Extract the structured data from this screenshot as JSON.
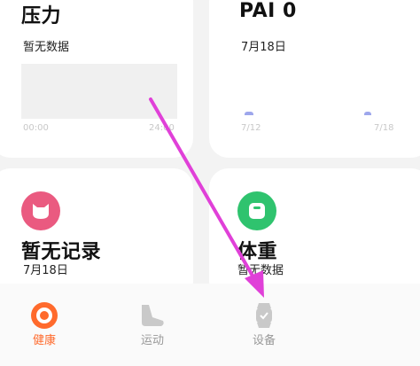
{
  "cards": {
    "pressure": {
      "title": "压力",
      "subtitle": "暂无数据",
      "axis_start": "00:00",
      "axis_end": "24:00"
    },
    "pai": {
      "title": "PAI 0",
      "subtitle": "7月18日",
      "axis_start": "7/12",
      "axis_end": "7/18"
    },
    "stress_record": {
      "title": "暂无记录",
      "subtitle": "7月18日",
      "icon": "cat-face-icon"
    },
    "weight": {
      "title": "体重",
      "subtitle": "暂无数据",
      "icon": "scale-icon"
    }
  },
  "nav": {
    "items": [
      {
        "label": "健康",
        "icon": "health-ring-icon",
        "active": true
      },
      {
        "label": "运动",
        "icon": "shoe-icon",
        "active": false
      },
      {
        "label": "设备",
        "icon": "watch-icon",
        "active": false
      }
    ]
  },
  "colors": {
    "accent": "#ff6a2c",
    "arrow": "#e040d8",
    "stress_icon_bg": "#ea5a80",
    "weight_icon_bg": "#2fc36e",
    "pai_bar": "#9ea7ec"
  }
}
